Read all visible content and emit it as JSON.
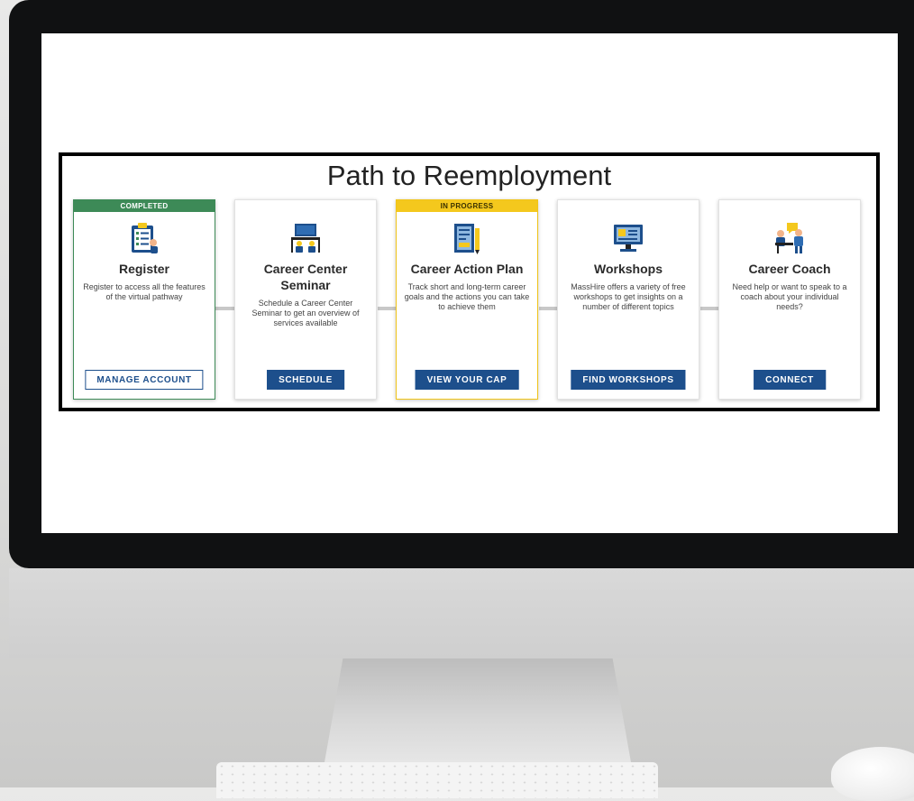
{
  "page": {
    "title": "Path to Reemployment"
  },
  "colors": {
    "completed": "#3d8a57",
    "in_progress": "#f4c81d",
    "button_primary": "#1d4f8c",
    "connector": "#c8c8c8"
  },
  "steps": [
    {
      "badge": "COMPLETED",
      "status": "completed",
      "icon": "clipboard-checklist-icon",
      "title": "Register",
      "description": "Register to access all the features of the virtual pathway",
      "button": "MANAGE ACCOUNT"
    },
    {
      "badge": "",
      "status": "none",
      "icon": "seminar-classroom-icon",
      "title": "Career Center Seminar",
      "description": "Schedule a Career Center Seminar to get an overview of services available",
      "button": "SCHEDULE"
    },
    {
      "badge": "IN PROGRESS",
      "status": "in_progress",
      "icon": "action-plan-document-icon",
      "title": "Career Action Plan",
      "description": "Track short and long-term career goals and the actions you can take to achieve them",
      "button": "VIEW YOUR CAP"
    },
    {
      "badge": "",
      "status": "none",
      "icon": "computer-monitor-icon",
      "title": "Workshops",
      "description": "MassHire offers a variety of free workshops to get insights on a number of different topics",
      "button": "FIND WORKSHOPS"
    },
    {
      "badge": "",
      "status": "none",
      "icon": "coach-meeting-icon",
      "title": "Career Coach",
      "description": "Need help or want to speak to a coach about your individual needs?",
      "button": "CONNECT"
    }
  ]
}
